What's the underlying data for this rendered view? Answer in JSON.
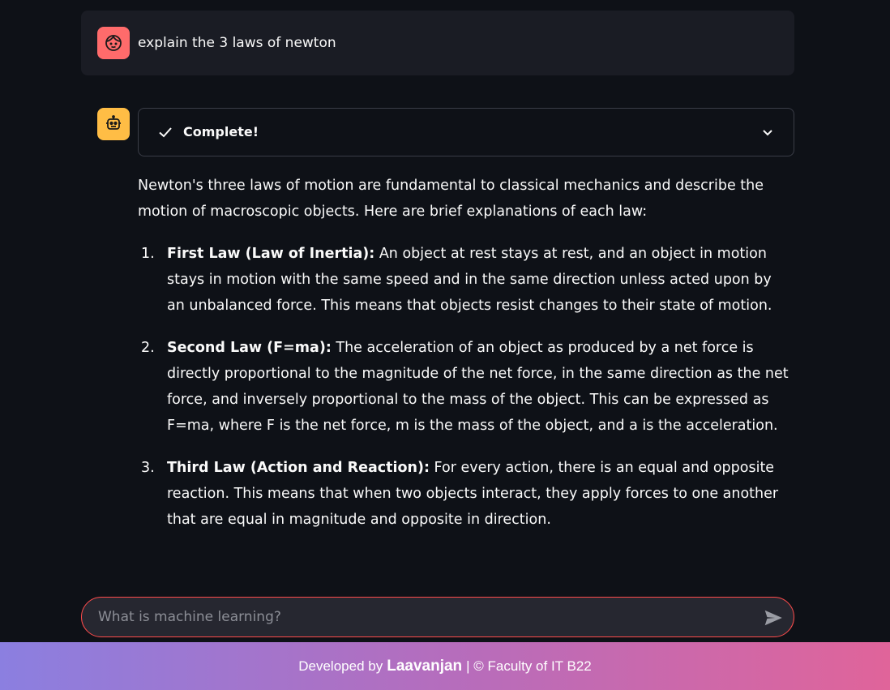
{
  "user_message": {
    "text": "explain the 3 laws of newton",
    "avatar_icon": "user-face-icon"
  },
  "assistant": {
    "avatar_icon": "robot-icon",
    "status": {
      "label": "Complete!",
      "icon": "check-icon",
      "expand_icon": "chevron-down-icon"
    },
    "intro": "Newton's three laws of motion are fundamental to classical mechanics and describe the motion of macroscopic objects. Here are brief explanations of each law:",
    "laws": [
      {
        "number": "1.",
        "title": "First Law (Law of Inertia):",
        "text": " An object at rest stays at rest, and an object in motion stays in motion with the same speed and in the same direction unless acted upon by an unbalanced force. This means that objects resist changes to their state of motion."
      },
      {
        "number": "2.",
        "title": "Second Law (F=ma):",
        "text": " The acceleration of an object as produced by a net force is directly proportional to the magnitude of the net force, in the same direction as the net force, and inversely proportional to the mass of the object. This can be expressed as F=ma, where F is the net force, m is the mass of the object, and a is the acceleration."
      },
      {
        "number": "3.",
        "title": "Third Law (Action and Reaction):",
        "text": " For every action, there is an equal and opposite reaction. This means that when two objects interact, they apply forces to one another that are equal in magnitude and opposite in direction."
      }
    ]
  },
  "chat_input": {
    "placeholder": "What is machine learning?",
    "value": "",
    "send_icon": "send-icon"
  },
  "footer": {
    "prefix": "Developed by",
    "author": "Laavanjan",
    "suffix": "| © Faculty of IT B22"
  },
  "colors": {
    "background": "#0e1117",
    "user_avatar": "#ff6b6b",
    "bot_avatar": "#ffbd45",
    "input_border": "#ff4b4b"
  }
}
